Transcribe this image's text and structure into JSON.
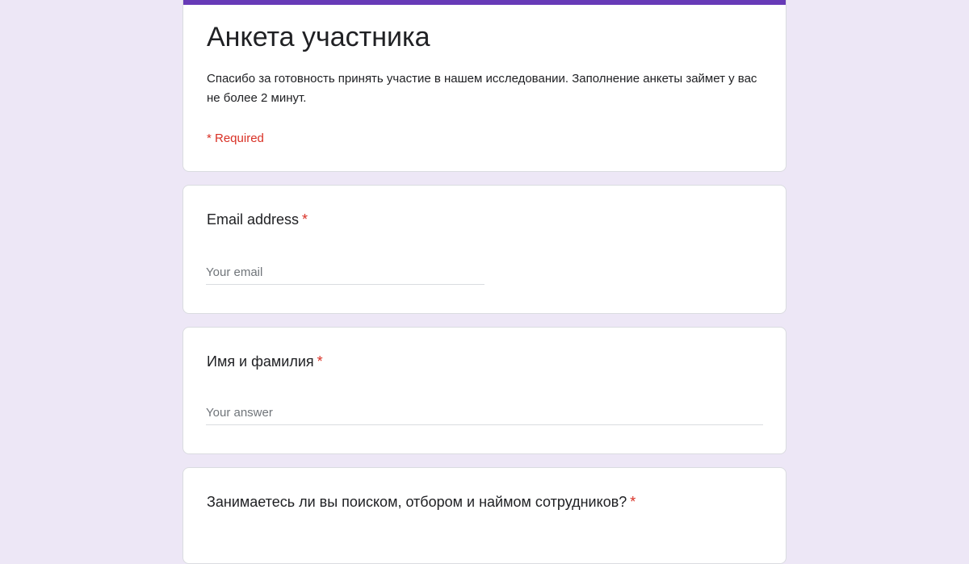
{
  "form": {
    "title": "Анкета участника",
    "description": "Спасибо за готовность принять участие в нашем исследовании. Заполнение анкеты займет у вас не более 2 минут.",
    "required_note": "* Required",
    "accent_color": "#673ab7",
    "background_color": "#ede7f6",
    "required_color": "#d93025"
  },
  "questions": {
    "email": {
      "label": "Email address",
      "required_mark": "*",
      "placeholder": "Your email"
    },
    "name": {
      "label": "Имя и фамилия",
      "required_mark": "*",
      "placeholder": "Your answer"
    },
    "hiring": {
      "label": "Занимаетесь ли вы поиском, отбором и наймом сотрудников?",
      "required_mark": "*"
    }
  }
}
